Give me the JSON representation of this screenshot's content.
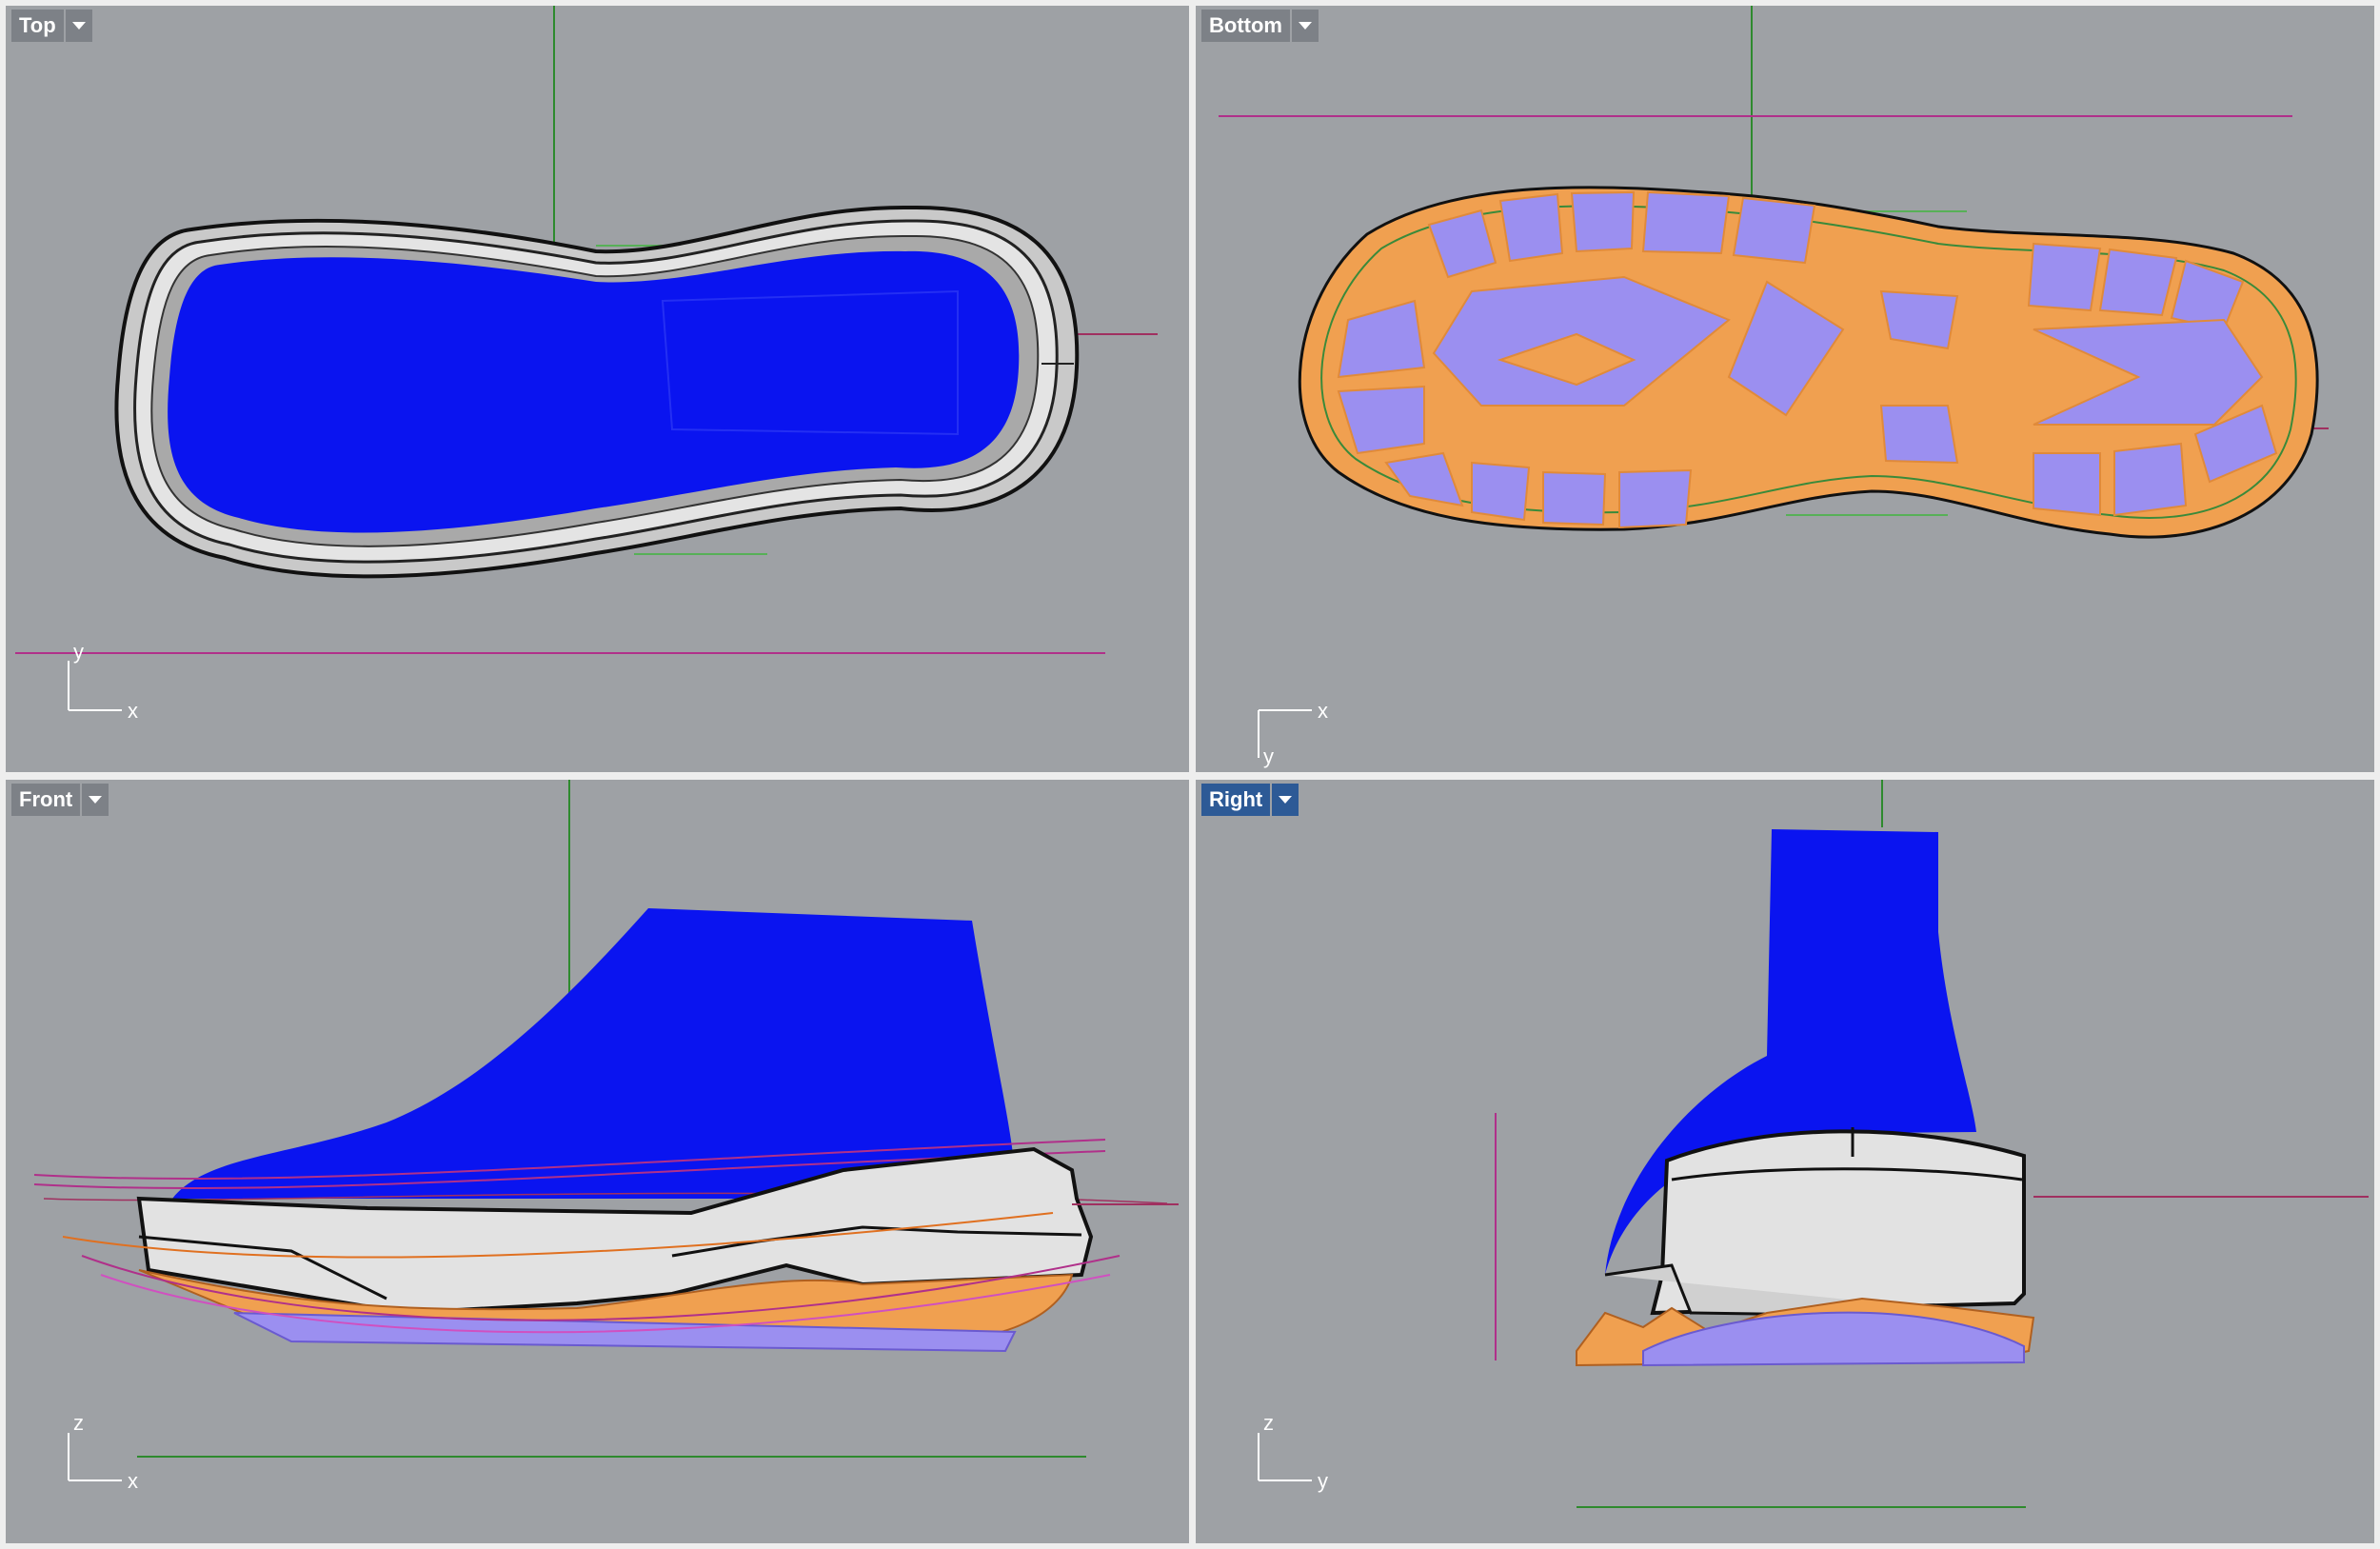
{
  "viewports": {
    "top": {
      "name": "Top",
      "axis_h": "x",
      "axis_v": "y",
      "active": false
    },
    "bottom": {
      "name": "Bottom",
      "axis_h": "x",
      "axis_v": "y",
      "active": false
    },
    "front": {
      "name": "Front",
      "axis_h": "x",
      "axis_v": "z",
      "active": false
    },
    "right": {
      "name": "Right",
      "axis_h": "y",
      "axis_v": "z",
      "active": true
    }
  },
  "colors": {
    "viewport_bg": "#9ea1a5",
    "label_bg": "#7d8187",
    "label_active_bg": "#2d5a96",
    "upper": "#0a14f0",
    "outsole_pad": "#9b8ff0",
    "outsole_frame": "#f0a050",
    "midsole": "#e2e2e2",
    "grid_x": "#b0308a",
    "grid_y": "#2e8a2e"
  },
  "icons": {
    "dropdown": "chevron-down-icon"
  }
}
